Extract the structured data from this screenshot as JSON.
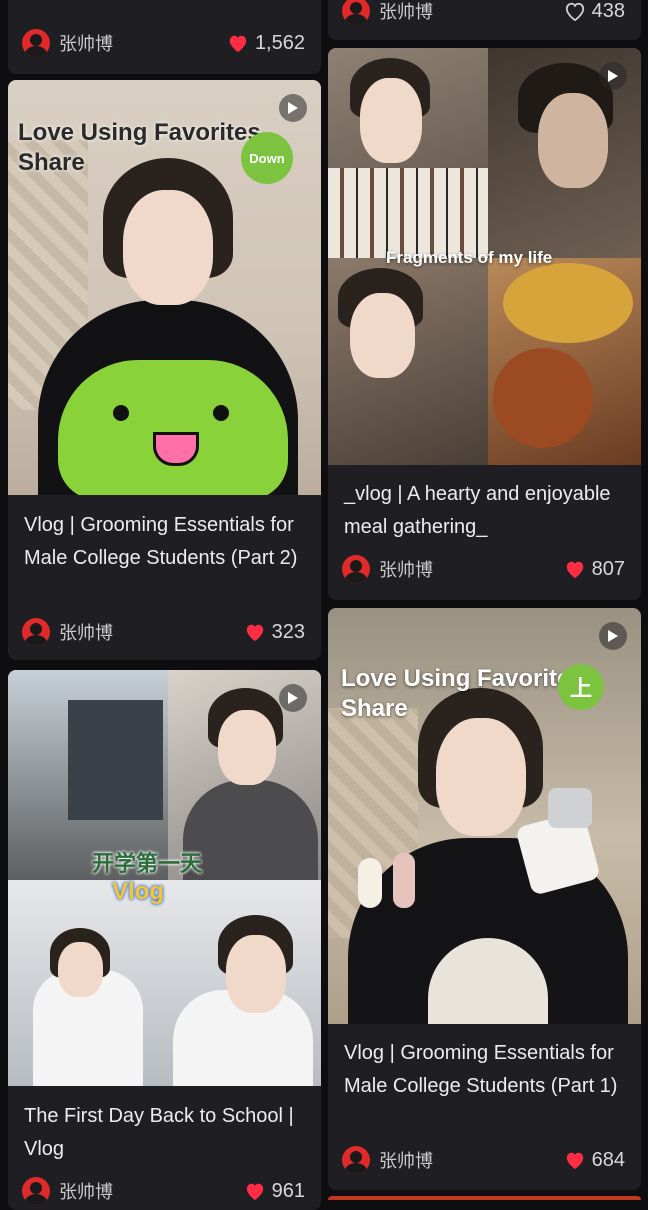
{
  "top_left": {
    "author": "张帅博",
    "likes": "1,562"
  },
  "top_right": {
    "author": "张帅博",
    "likes": "438"
  },
  "cards": [
    {
      "overlay_title": "Love Using Favorites Share",
      "badge": "Down",
      "title": "Vlog | Grooming Essentials for Male College Students (Part 2)",
      "author": "张帅博",
      "likes": "323"
    },
    {
      "overlay_title": "Fragments of my life",
      "title": "_vlog | A hearty and enjoyable meal gathering_",
      "author": "张帅博",
      "likes": "807"
    },
    {
      "overlay_title": "开学第一天",
      "overlay_sub": "Vlog",
      "title": "The First Day Back to School | Vlog",
      "author": "张帅博",
      "likes": "961"
    },
    {
      "overlay_title": "Love Using Favorites Share",
      "badge": "上",
      "title": "Vlog | Grooming Essentials for Male College Students (Part 1)",
      "author": "张帅博",
      "likes": "684"
    }
  ],
  "colors": {
    "background": "#0e0e10",
    "card": "#1f1f23",
    "heart": "#ff2d44",
    "avatar": "#e02a2a",
    "badge": "#7cc43f"
  }
}
